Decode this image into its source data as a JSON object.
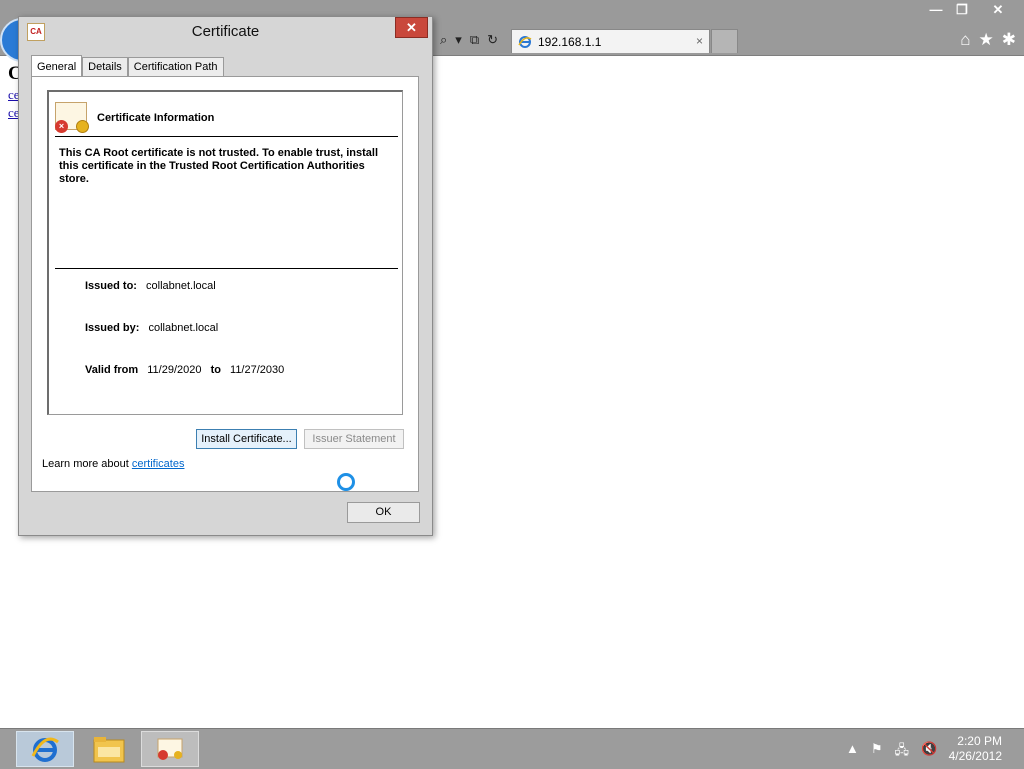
{
  "browser": {
    "tab": {
      "title": "192.168.1.1",
      "close_glyph": "×"
    },
    "window_controls": {
      "minimize": "—",
      "restore": "❐",
      "close": "✕"
    },
    "address_tools": {
      "search": "⌕",
      "dropdown": "▾",
      "compat": "⧉",
      "refresh": "↻"
    },
    "right_icons": {
      "home": "⌂",
      "favorites": "★",
      "tools": "✱"
    },
    "page_fragment": {
      "title": "C",
      "link1": "ce",
      "link2": "ce"
    }
  },
  "dialog": {
    "title": "Certificate",
    "icon_text": "CA",
    "close_glyph": "✕",
    "tabs": [
      "General",
      "Details",
      "Certification Path"
    ],
    "heading": "Certificate Information",
    "message": "This CA Root certificate is not trusted. To enable trust, install this certificate in the Trusted Root Certification Authorities store.",
    "issued_to_label": "Issued to:",
    "issued_to": "collabnet.local",
    "issued_by_label": "Issued by:",
    "issued_by": "collabnet.local",
    "valid_from_label": "Valid from",
    "valid_from": "11/29/2020",
    "to_label": "to",
    "valid_to": "11/27/2030",
    "install_button": "Install Certificate...",
    "issuer_button": "Issuer Statement",
    "learn_more_prefix": "Learn more about ",
    "learn_more_link": "certificates",
    "ok_button": "OK"
  },
  "taskbar": {
    "tray": {
      "chevron": "▲",
      "flag": "⚑",
      "network": "🖧",
      "volume": "🔇"
    },
    "time": "2:20 PM",
    "date": "4/26/2012"
  },
  "colors": {
    "accent": "#1e90e6",
    "link": "#0066cc",
    "close_red": "#c9483c"
  }
}
